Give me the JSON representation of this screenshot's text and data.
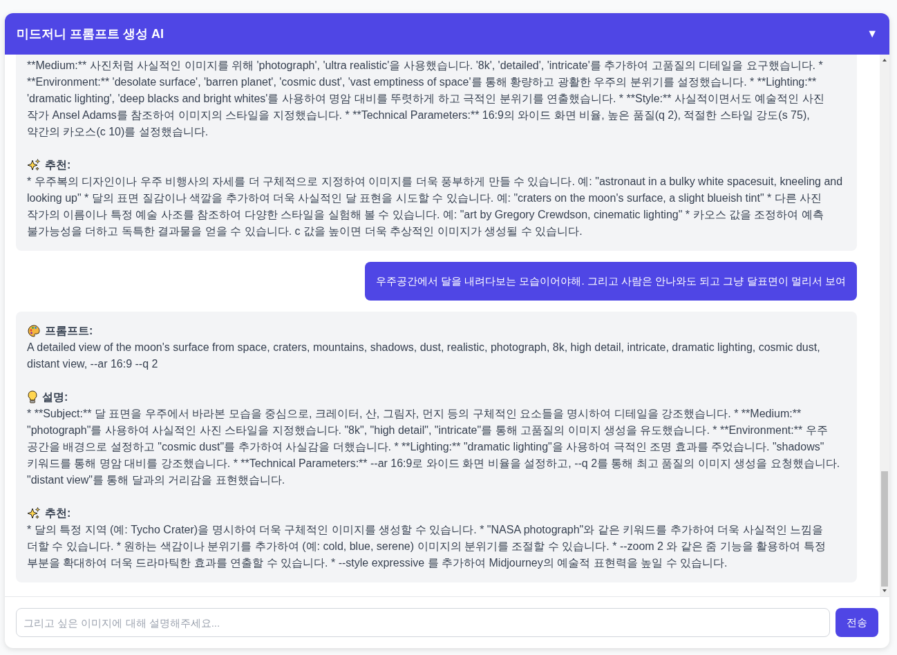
{
  "header": {
    "title": "미드저니 프롬프트 생성 AI",
    "toggle": "▼"
  },
  "messages": [
    {
      "kind": "bot",
      "sections": [
        {
          "kind": "continued",
          "body": "**Medium:** 사진처럼 사실적인 이미지를 위해 'photograph', 'ultra realistic'을 사용했습니다. '8k', 'detailed', 'intricate'를 추가하여 고품질의 디테일을 요구했습니다. * **Environment:** 'desolate surface', 'barren planet', 'cosmic dust', 'vast emptiness of space'를 통해 황량하고 광활한 우주의 분위기를 설정했습니다. * **Lighting:** 'dramatic lighting', 'deep blacks and bright whites'를 사용하여 명암 대비를 뚜렷하게 하고 극적인 분위기를 연출했습니다. * **Style:** 사실적이면서도 예술적인 사진 작가 Ansel Adams를 참조하여 이미지의 스타일을 지정했습니다. * **Technical Parameters:** 16:9의 와이드 화면 비율, 높은 품질(q 2), 적절한 스타일 강도(s 75), 약간의 카오스(c 10)를 설정했습니다."
        },
        {
          "kind": "recommendation",
          "heading": "추천:",
          "body": "* 우주복의 디자인이나 우주 비행사의 자세를 더 구체적으로 지정하여 이미지를 더욱 풍부하게 만들 수 있습니다. 예: \"astronaut in a bulky white spacesuit, kneeling and looking up\" * 달의 표면 질감이나 색깔을 추가하여 더욱 사실적인 달 표현을 시도할 수 있습니다. 예: \"craters on the moon's surface, a slight blueish tint\" * 다른 사진 작가의 이름이나 특정 예술 사조를 참조하여 다양한 스타일을 실험해 볼 수 있습니다. 예: \"art by Gregory Crewdson, cinematic lighting\" * 카오스 값을 조정하여 예측 불가능성을 더하고 독특한 결과물을 얻을 수 있습니다. c 값을 높이면 더욱 추상적인 이미지가 생성될 수 있습니다."
        }
      ]
    },
    {
      "kind": "user",
      "text": "우주공간에서 달을 내려다보는 모습이어야해. 그리고 사람은 안나와도 되고 그냥 달표면이 멀리서 보여"
    },
    {
      "kind": "bot",
      "sections": [
        {
          "kind": "prompt",
          "heading": "프롬프트:",
          "body": "A detailed view of the moon's surface from space, craters, mountains, shadows, dust, realistic, photograph, 8k, high detail, intricate, dramatic lighting, cosmic dust, distant view, --ar 16:9 --q 2"
        },
        {
          "kind": "explanation",
          "heading": "설명:",
          "body": "* **Subject:** 달 표면을 우주에서 바라본 모습을 중심으로, 크레이터, 산, 그림자, 먼지 등의 구체적인 요소들을 명시하여 디테일을 강조했습니다. * **Medium:** \"photograph\"를 사용하여 사실적인 사진 스타일을 지정했습니다. \"8k\", \"high detail\", \"intricate\"를 통해 고품질의 이미지 생성을 유도했습니다. * **Environment:** 우주 공간을 배경으로 설정하고 \"cosmic dust\"를 추가하여 사실감을 더했습니다. * **Lighting:** \"dramatic lighting\"을 사용하여 극적인 조명 효과를 주었습니다. \"shadows\" 키워드를 통해 명암 대비를 강조했습니다. * **Technical Parameters:** --ar 16:9로 와이드 화면 비율을 설정하고, --q 2를 통해 최고 품질의 이미지 생성을 요청했습니다. \"distant view\"를 통해 달과의 거리감을 표현했습니다."
        },
        {
          "kind": "recommendation",
          "heading": "추천:",
          "body": "* 달의 특정 지역 (예: Tycho Crater)을 명시하여 더욱 구체적인 이미지를 생성할 수 있습니다. * \"NASA photograph\"와 같은 키워드를 추가하여 더욱 사실적인 느낌을 더할 수 있습니다. * 원하는 색감이나 분위기를 추가하여 (예: cold, blue, serene) 이미지의 분위기를 조절할 수 있습니다. * --zoom 2 와 같은 줌 기능을 활용하여 특정 부분을 확대하여 더욱 드라마틱한 효과를 연출할 수 있습니다. * --style expressive 를 추가하여 Midjourney의 예술적 표현력을 높일 수 있습니다."
        }
      ]
    }
  ],
  "composer": {
    "placeholder": "그리고 싶은 이미지에 대해 설명해주세요...",
    "send": "전송"
  }
}
